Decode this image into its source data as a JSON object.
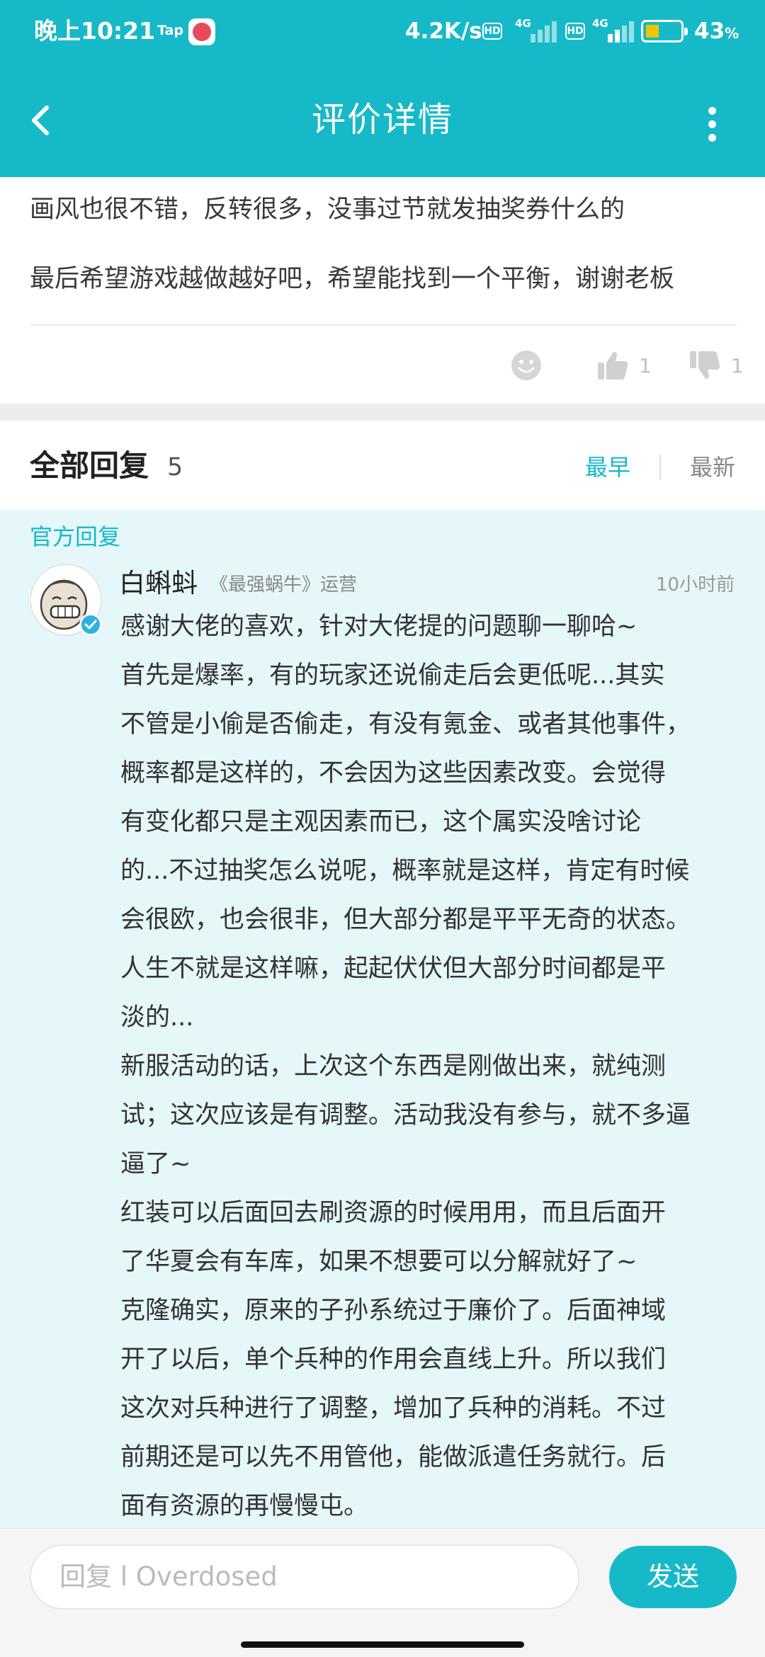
{
  "status_bar": {
    "time": "晚上10:21",
    "tap_label": "Tap",
    "net_speed": "4.2K/s",
    "hd": "HD",
    "net_type": "4G",
    "battery_pct": "43",
    "battery_unit": "%"
  },
  "header": {
    "title": "评价详情",
    "back_icon": "chevron-left-icon",
    "more_icon": "more-vertical-icon",
    "color": "#16b9c8"
  },
  "review": {
    "lines": [
      "画风也很不错，反转很多，没事过节就发抽奖券什么的",
      "最后希望游戏越做越好吧，希望能找到一个平衡，谢谢老板"
    ],
    "likes": "1",
    "dislikes": "1"
  },
  "replies": {
    "title": "全部回复",
    "count": "5",
    "sort_earliest": "最早",
    "sort_latest": "最新"
  },
  "official_reply": {
    "tag": "官方回复",
    "author": "白蝌蚪",
    "role": "《最强蜗牛》运营",
    "time": "10小时前",
    "lines": [
      "感谢大佬的喜欢，针对大佬提的问题聊一聊哈~",
      "首先是爆率，有的玩家还说偷走后会更低呢...其实",
      "不管是小偷是否偷走，有没有氪金、或者其他事件，",
      "概率都是这样的，不会因为这些因素改变。会觉得",
      "有变化都只是主观因素而已，这个属实没啥讨论",
      "的...不过抽奖怎么说呢，概率就是这样，肯定有时候",
      "会很欧，也会很非，但大部分都是平平无奇的状态。",
      "人生不就是这样嘛，起起伏伏但大部分时间都是平",
      "淡的...",
      "新服活动的话，上次这个东西是刚做出来，就纯测",
      "试；这次应该是有调整。活动我没有参与，就不多逼",
      "逼了~",
      "红装可以后面回去刷资源的时候用用，而且后面开",
      "了华夏会有车库，如果不想要可以分解就好了~",
      "克隆确实，原来的子孙系统过于廉价了。后面神域",
      "开了以后，单个兵种的作用会直线上升。所以我们",
      "这次对兵种进行了调整，增加了兵种的消耗。不过",
      "前期还是可以先不用管他，能做派遣任务就行。后",
      "面有资源的再慢慢屯。"
    ]
  },
  "composer": {
    "placeholder": "回复 l  Overdosed",
    "send_label": "发送"
  }
}
